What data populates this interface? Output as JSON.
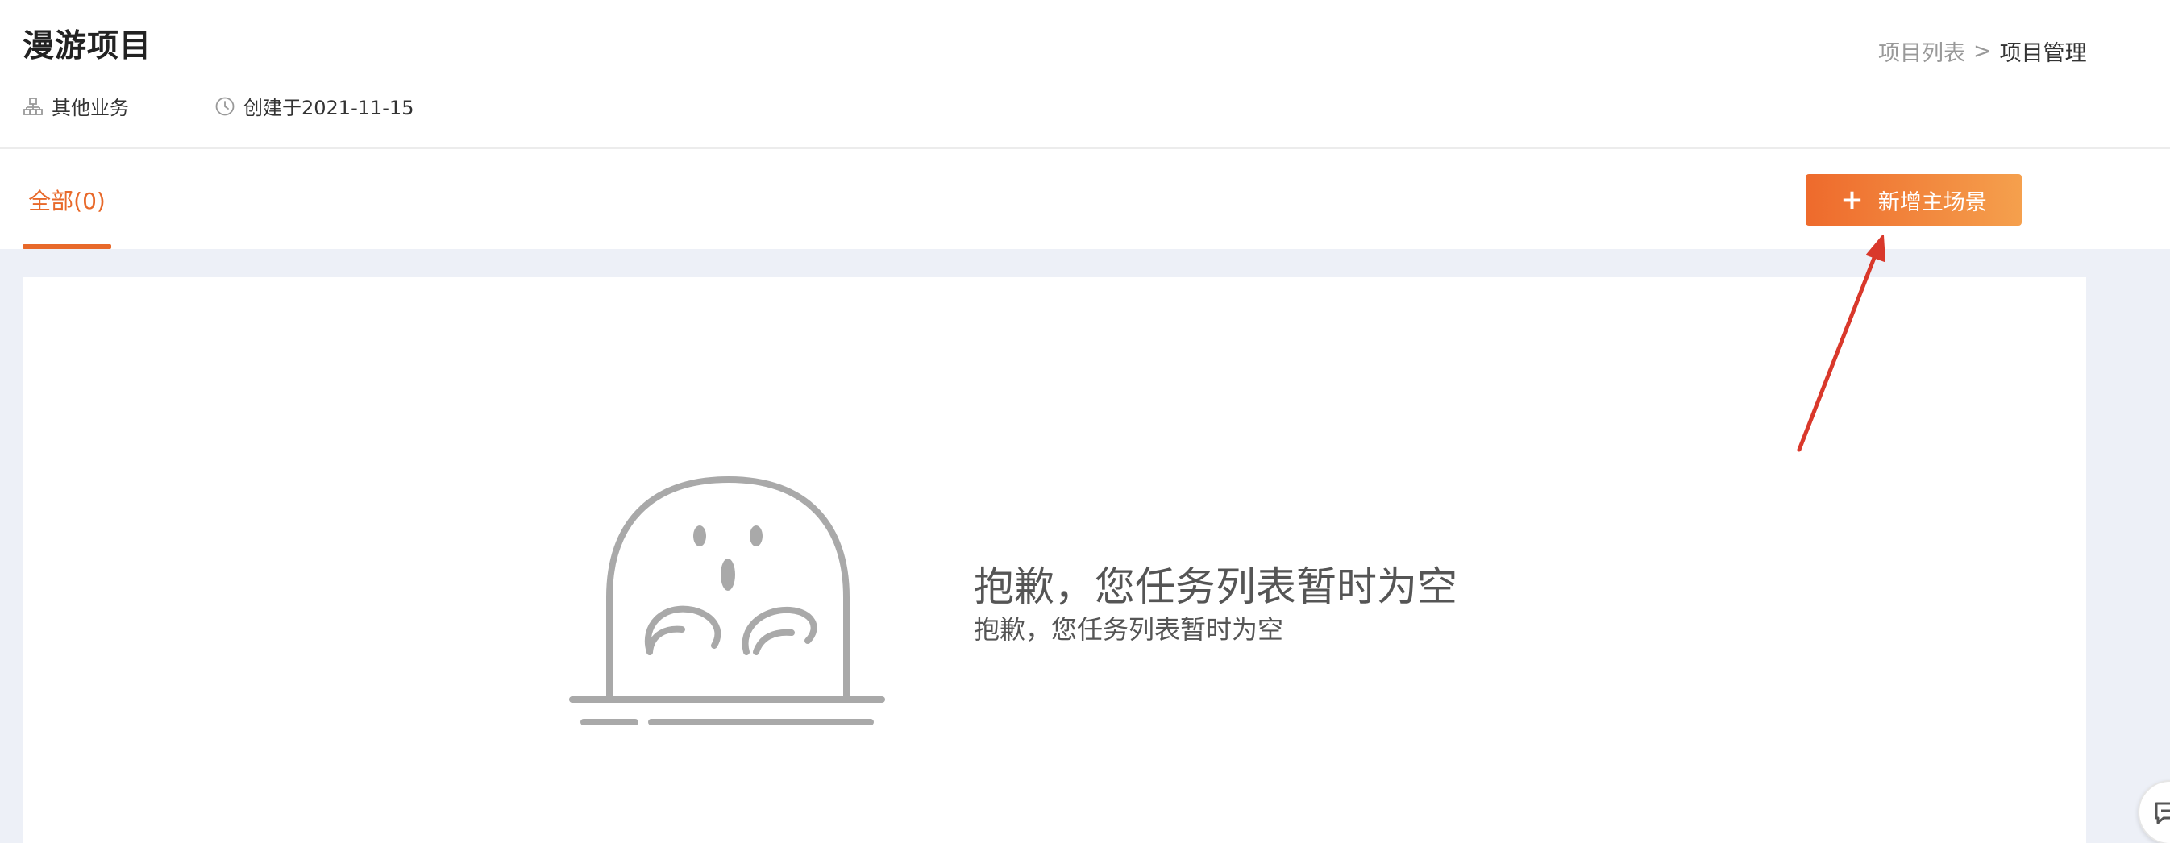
{
  "header": {
    "title": "漫游项目",
    "business_label": "其他业务",
    "created_label": "创建于2021-11-15"
  },
  "breadcrumb": {
    "link": "项目列表",
    "separator": ">",
    "current": "项目管理"
  },
  "tabs": [
    {
      "label": "全部(0)",
      "active": true
    }
  ],
  "actions": {
    "add_main_scene": "新增主场景",
    "add_icon": "+"
  },
  "empty_state": {
    "title": "抱歉，您任务列表暂时为空",
    "subtitle": "抱歉，您任务列表暂时为空"
  },
  "icons": {
    "business": "org-chart-icon",
    "created": "clock-icon",
    "empty": "ghost-illustration",
    "widget": "feedback-icon"
  },
  "colors": {
    "accent": "#e8692a",
    "button_gradient_start": "#ee6a2c",
    "button_gradient_end": "#f5a04d",
    "content_background": "#edf0f7",
    "annotation_arrow": "#d9382b"
  }
}
